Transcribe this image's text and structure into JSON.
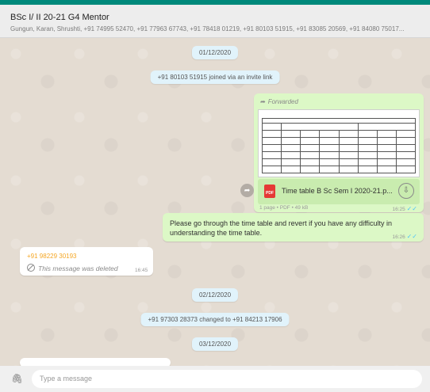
{
  "header": {
    "title": "BSc I/ II 20-21 G4 Mentor",
    "members": "Gungun, Karan, Shrushti, +91 74995 52470, +91 77963 67743, +91 78418 01219, +91 80103 51915, +91 83085 20569, +91 84080 75017..."
  },
  "messages": {
    "date1": "01/12/2020",
    "joined": "+91 80103 51915 joined via an invite link",
    "forwarded_label": "Forwarded",
    "doc_name": "Time table B Sc Sem I 2020-21.p...",
    "doc_meta": "1 page • PDF • 49 kB",
    "doc_time": "16:25",
    "text_msg": "Please go through the time table and revert if you have any difficulty in understanding the time table.",
    "text_time": "16:26",
    "sender": "+91 98229 30193",
    "deleted_text": "This message was deleted",
    "deleted_time": "16:45",
    "date2": "02/12/2020",
    "changed": "+91 97303 28373 changed to +91 84213 17906",
    "date3": "03/12/2020"
  },
  "composer": {
    "placeholder": "Type a message"
  },
  "colors": {
    "accent": "#00897b",
    "outgoing_bubble": "#dcf8c6",
    "incoming_bubble": "#ffffff",
    "sender_name": "#f5a623",
    "read_tick": "#4fc3f7"
  },
  "icons": [
    "forward-icon",
    "pdf-icon",
    "download-icon",
    "share-icon",
    "deleted-icon",
    "read-tick-icon",
    "attach-icon"
  ]
}
